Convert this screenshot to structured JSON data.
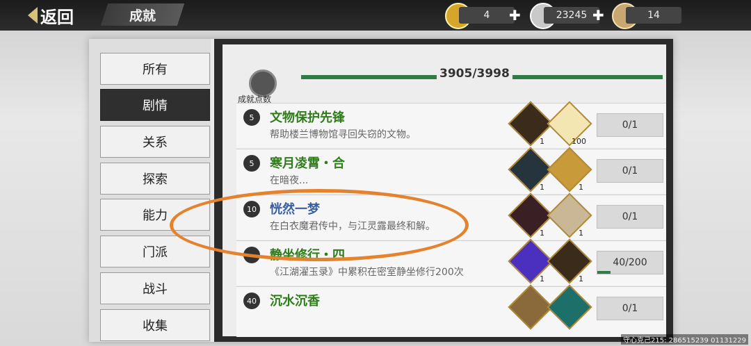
{
  "header": {
    "back_label": "返回",
    "title": "成就",
    "currencies": [
      {
        "icon": "gold-ingot-icon",
        "value": "4"
      },
      {
        "icon": "silver-ingot-icon",
        "value": "23245"
      },
      {
        "icon": "scroll-icon",
        "value": "14"
      }
    ]
  },
  "sidebar": {
    "items": [
      {
        "label": "所有",
        "active": false
      },
      {
        "label": "剧情",
        "active": true
      },
      {
        "label": "关系",
        "active": false
      },
      {
        "label": "探索",
        "active": false
      },
      {
        "label": "能力",
        "active": false
      },
      {
        "label": "门派",
        "active": false
      },
      {
        "label": "战斗",
        "active": false
      },
      {
        "label": "收集",
        "active": false
      }
    ]
  },
  "progress": {
    "badge_label": "成就点数",
    "value_text": "3905/3998",
    "value": 3905,
    "max": 3998
  },
  "achievements": [
    {
      "points": "5",
      "name": "文物保护先锋",
      "desc": "帮助楼兰博物馆寻回失窃的文物。",
      "rewards": [
        {
          "icon": "title-token-icon",
          "count": "1"
        },
        {
          "icon": "silver-ingot-icon",
          "count": "100"
        }
      ],
      "status": "0/1",
      "progress": 0
    },
    {
      "points": "5",
      "name": "寒月凌霄・合",
      "desc": "在暗夜...",
      "rewards": [
        {
          "icon": "portrait-card-icon",
          "count": "1"
        },
        {
          "icon": "golden-card-icon",
          "count": "1"
        }
      ],
      "status": "0/1",
      "progress": 0
    },
    {
      "points": "10",
      "name": "恍然一梦",
      "desc": "在白衣魔君传中，与江灵露最终和解。",
      "rewards": [
        {
          "icon": "portrait-card-icon",
          "count": "1"
        },
        {
          "icon": "jade-card-icon",
          "count": "1"
        }
      ],
      "status": "0/1",
      "progress": 0
    },
    {
      "points": "",
      "name": "静坐修行・四",
      "desc": "《江湖濯玉录》中累积在密室静坐修行200次",
      "rewards": [
        {
          "icon": "purple-flame-card-icon",
          "count": "1"
        },
        {
          "icon": "title-token-icon",
          "count": "1"
        }
      ],
      "status": "40/200",
      "progress": 0.2
    },
    {
      "points": "40",
      "name": "沉水沉香",
      "desc": "",
      "rewards": [
        {
          "icon": "gold-card-icon",
          "count": ""
        },
        {
          "icon": "teal-orb-card-icon",
          "count": ""
        }
      ],
      "status": "0/1",
      "progress": 0
    }
  ],
  "footer": {
    "text": "守心克己215: 286515239  01131229"
  },
  "colors": {
    "green": "#2f7d1a",
    "bar": "#2f7d44",
    "annotation": "#e5822e"
  }
}
